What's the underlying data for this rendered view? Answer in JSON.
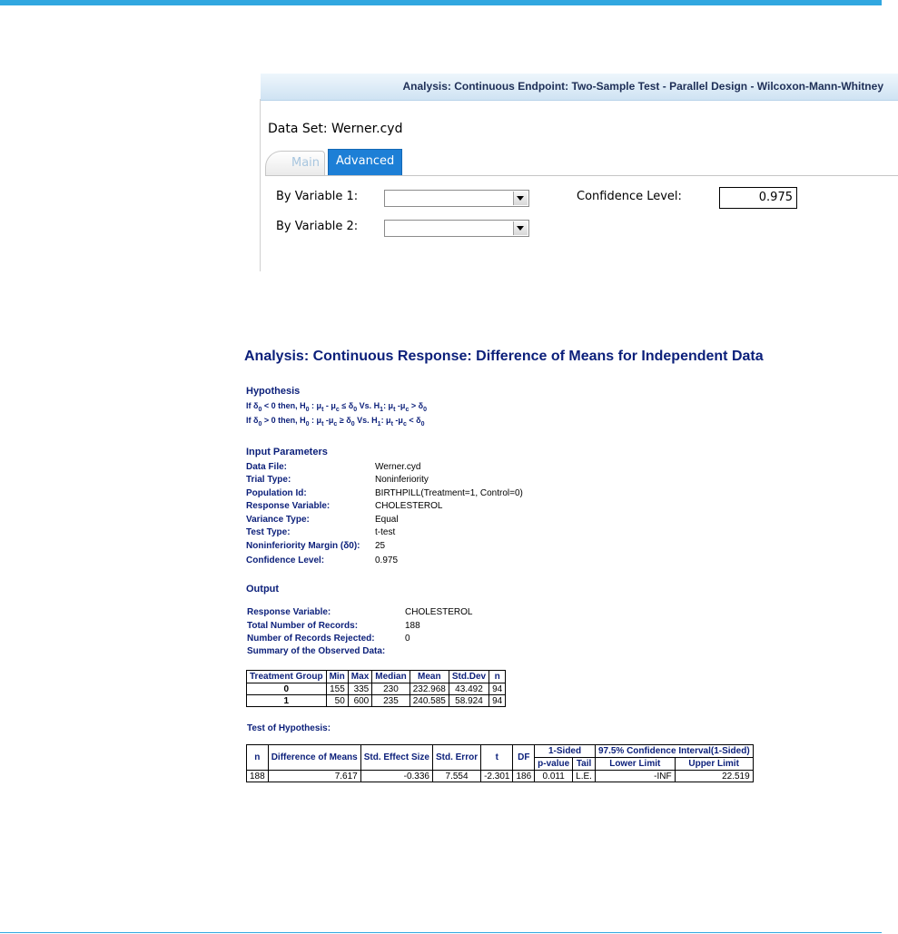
{
  "dialog": {
    "title": "Analysis: Continuous Endpoint: Two-Sample Test - Parallel Design - Wilcoxon-Mann-Whitney",
    "dataset_label": "Data Set: Werner.cyd",
    "tabs": [
      {
        "label": "Main"
      },
      {
        "label": "Advanced"
      }
    ],
    "by_variable_1_label": "By Variable 1:",
    "by_variable_2_label": "By Variable 2:",
    "confidence_label": "Confidence Level:",
    "confidence_value": "0.975"
  },
  "report": {
    "title": "Analysis: Continuous Response: Difference of Means for Independent Data",
    "hypothesis_heading": "Hypothesis",
    "input_heading": "Input Parameters",
    "inputs": [
      {
        "key": "Data File:",
        "value": "Werner.cyd"
      },
      {
        "key": "Trial Type:",
        "value": "Noninferiority"
      },
      {
        "key": "Population Id:",
        "value": "BIRTHPILL(Treatment=1, Control=0)"
      },
      {
        "key": "Response Variable:",
        "value": "CHOLESTEROL"
      },
      {
        "key": "Variance Type:",
        "value": "Equal"
      },
      {
        "key": "Test Type:",
        "value": "t-test"
      },
      {
        "key": "Noninferiority Margin (δ0):",
        "value": "25"
      },
      {
        "key": "Confidence Level:",
        "value": "0.975"
      }
    ],
    "output_heading": "Output",
    "outputs": [
      {
        "key": "Response Variable:",
        "value": "CHOLESTEROL"
      },
      {
        "key": "Total Number of Records:",
        "value": "188"
      },
      {
        "key": "Number of Records Rejected:",
        "value": "0"
      },
      {
        "key": "Summary of the Observed Data:",
        "value": ""
      }
    ],
    "summary_table": {
      "headers": [
        "Treatment Group",
        "Min",
        "Max",
        "Median",
        "Mean",
        "Std.Dev",
        "n"
      ],
      "rows": [
        [
          "0",
          "155",
          "335",
          "230",
          "232.968",
          "43.492",
          "94"
        ],
        [
          "1",
          "50",
          "600",
          "235",
          "240.585",
          "58.924",
          "94"
        ]
      ]
    },
    "test_heading": "Test of Hypothesis:",
    "test_table": {
      "headers": [
        "n",
        "Difference of Means",
        "Std. Effect Size",
        "Std. Error",
        "t",
        "DF"
      ],
      "group_1sided": "1-Sided",
      "group_ci": "97.5% Confidence Interval(1-Sided)",
      "sub_headers": [
        "p-value",
        "Tail",
        "Lower Limit",
        "Upper Limit"
      ],
      "row": [
        "188",
        "7.617",
        "-0.336",
        "7.554",
        "-2.301",
        "186",
        "0.011",
        "L.E.",
        "-INF",
        "22.519"
      ]
    }
  }
}
